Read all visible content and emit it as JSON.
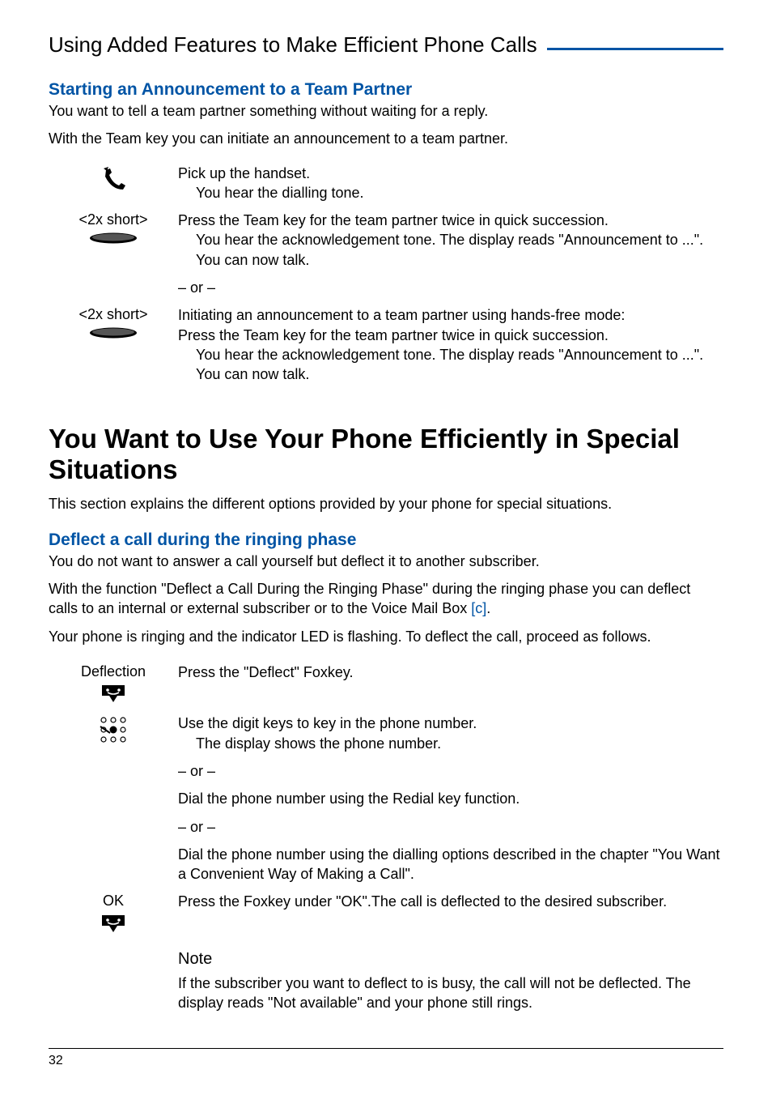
{
  "header": {
    "title": "Using Added Features to Make Efficient Phone Calls"
  },
  "icons": {
    "handset": "handset-icon",
    "softkey": "softkey-icon",
    "foxkey": "foxkey-icon",
    "keypad": "keypad-icon"
  },
  "section1": {
    "heading": "Starting an Announcement to a Team Partner",
    "intro1": "You want to tell a team partner something without waiting for a reply.",
    "intro2": "With the Team key you can initiate an announcement to a team partner.",
    "steps": {
      "pickup": {
        "line1": "Pick up the handset.",
        "line2": "You hear the dialling tone."
      },
      "short_label": "<2x short>",
      "press1": {
        "line1": "Press the Team key for the team partner twice in quick succession.",
        "line2": "You hear the acknowledgement tone. The display reads \"Announcement to ...\". You can now talk."
      },
      "or": "– or –",
      "press2": {
        "line0": "Initiating an announcement to a team partner using hands-free mode:",
        "line1": "Press the Team key for the team partner twice in quick succession.",
        "line2": "You hear the acknowledgement tone. The display reads \"Announcement to ...\". You can now talk."
      }
    }
  },
  "section2": {
    "heading": "You Want to Use Your Phone Efficiently in Special Situations",
    "intro": "This section explains the different options provided by your phone for special situations.",
    "sub1": {
      "heading": "Deflect a call during the ringing phase",
      "intro1": "You do not want to answer a call yourself but deflect it to another subscriber.",
      "intro2a": "With the function \"Deflect a Call During the Ringing Phase\" during the ringing phase you can deflect calls to an internal or external subscriber or to the Voice Mail Box ",
      "intro2b": "[c]",
      "intro2c": ".",
      "intro3": "Your phone is ringing and the indicator LED is flashing. To deflect the call, proceed as follows.",
      "deflect_label": "Deflection",
      "deflect_action": "Press the \"Deflect\" Foxkey.",
      "keypad1": "Use the digit keys to key in the phone number.",
      "keypad2": "The display shows the phone number.",
      "or": "– or –",
      "redial": "Dial the phone number using the Redial key function.",
      "chapter": "Dial the phone number using the dialling options described in the chapter \"You Want a Convenient Way of Making a Call\".",
      "ok_label": "OK",
      "ok_action": "Press the Foxkey under \"OK\".The call is deflected to the desired subscriber.",
      "note_h": "Note",
      "note_body": "If the subscriber you want to deflect to is busy, the call will not be deflected. The display reads \"Not available\" and your phone still rings."
    }
  },
  "footer": {
    "pagenum": "32"
  }
}
